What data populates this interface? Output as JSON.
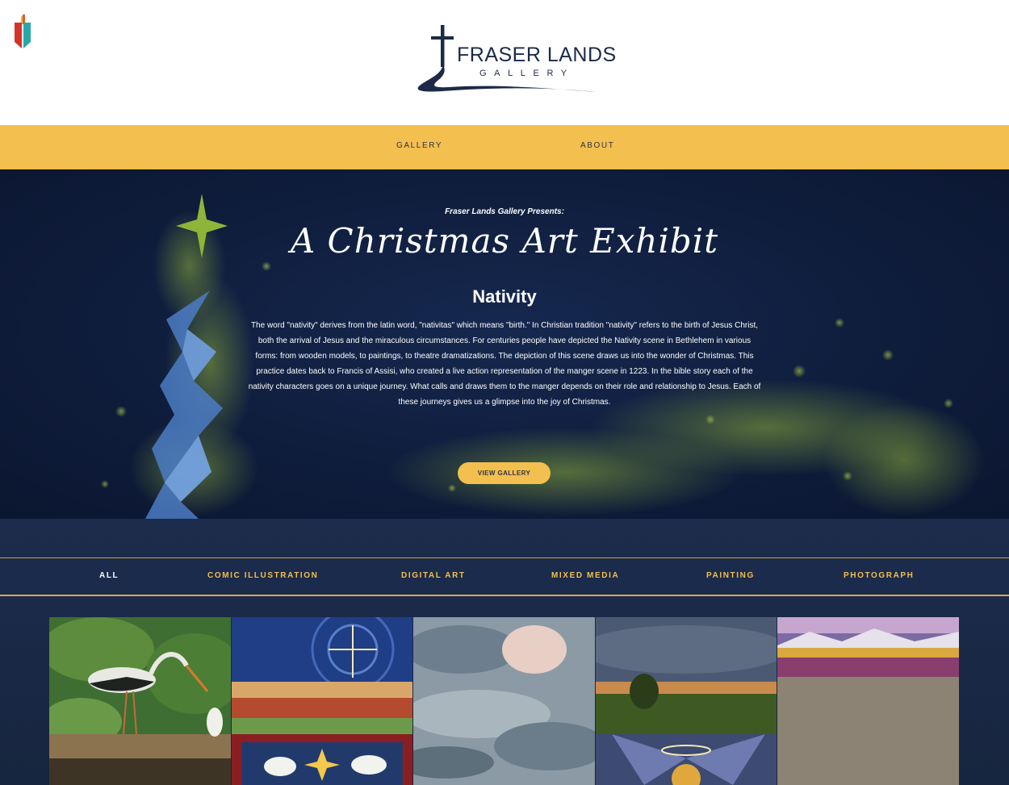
{
  "header": {
    "logo_title": "FRASER LANDS",
    "logo_subtitle": "GALLERY"
  },
  "nav": {
    "items": [
      "GALLERY",
      "ABOUT"
    ]
  },
  "hero": {
    "presents": "Fraser Lands Gallery Presents:",
    "title": "A Christmas Art Exhibit",
    "heading": "Nativity",
    "description": "The word \"nativity\" derives from the latin word, \"nativitas\" which means \"birth.\" In Christian tradition \"nativity\" refers to the birth of Jesus Christ, both the arrival of Jesus and the miraculous circumstances. For centuries people have depicted the Nativity scene in Bethlehem in various forms: from wooden models, to paintings, to theatre dramatizations. The depiction of this scene draws us into the wonder of Christmas. This practice dates back to Francis of Assisi, who created a live action representation of the manger scene in 1223. In the bible story each of the nativity characters goes on a unique journey. What calls and draws them to the manger depends on their role and relationship to Jesus. Each of these journeys gives us a glimpse into the joy of Christmas.",
    "button": "VIEW GALLERY"
  },
  "filters": {
    "items": [
      "ALL",
      "COMIC ILLUSTRATION",
      "DIGITAL ART",
      "MIXED MEDIA",
      "PAINTING",
      "PHOTOGRAPH"
    ],
    "active": "ALL"
  },
  "colors": {
    "accent": "#f3bf4f",
    "navy": "#1b2b4b",
    "hero_bg": "#0f1d3c"
  }
}
